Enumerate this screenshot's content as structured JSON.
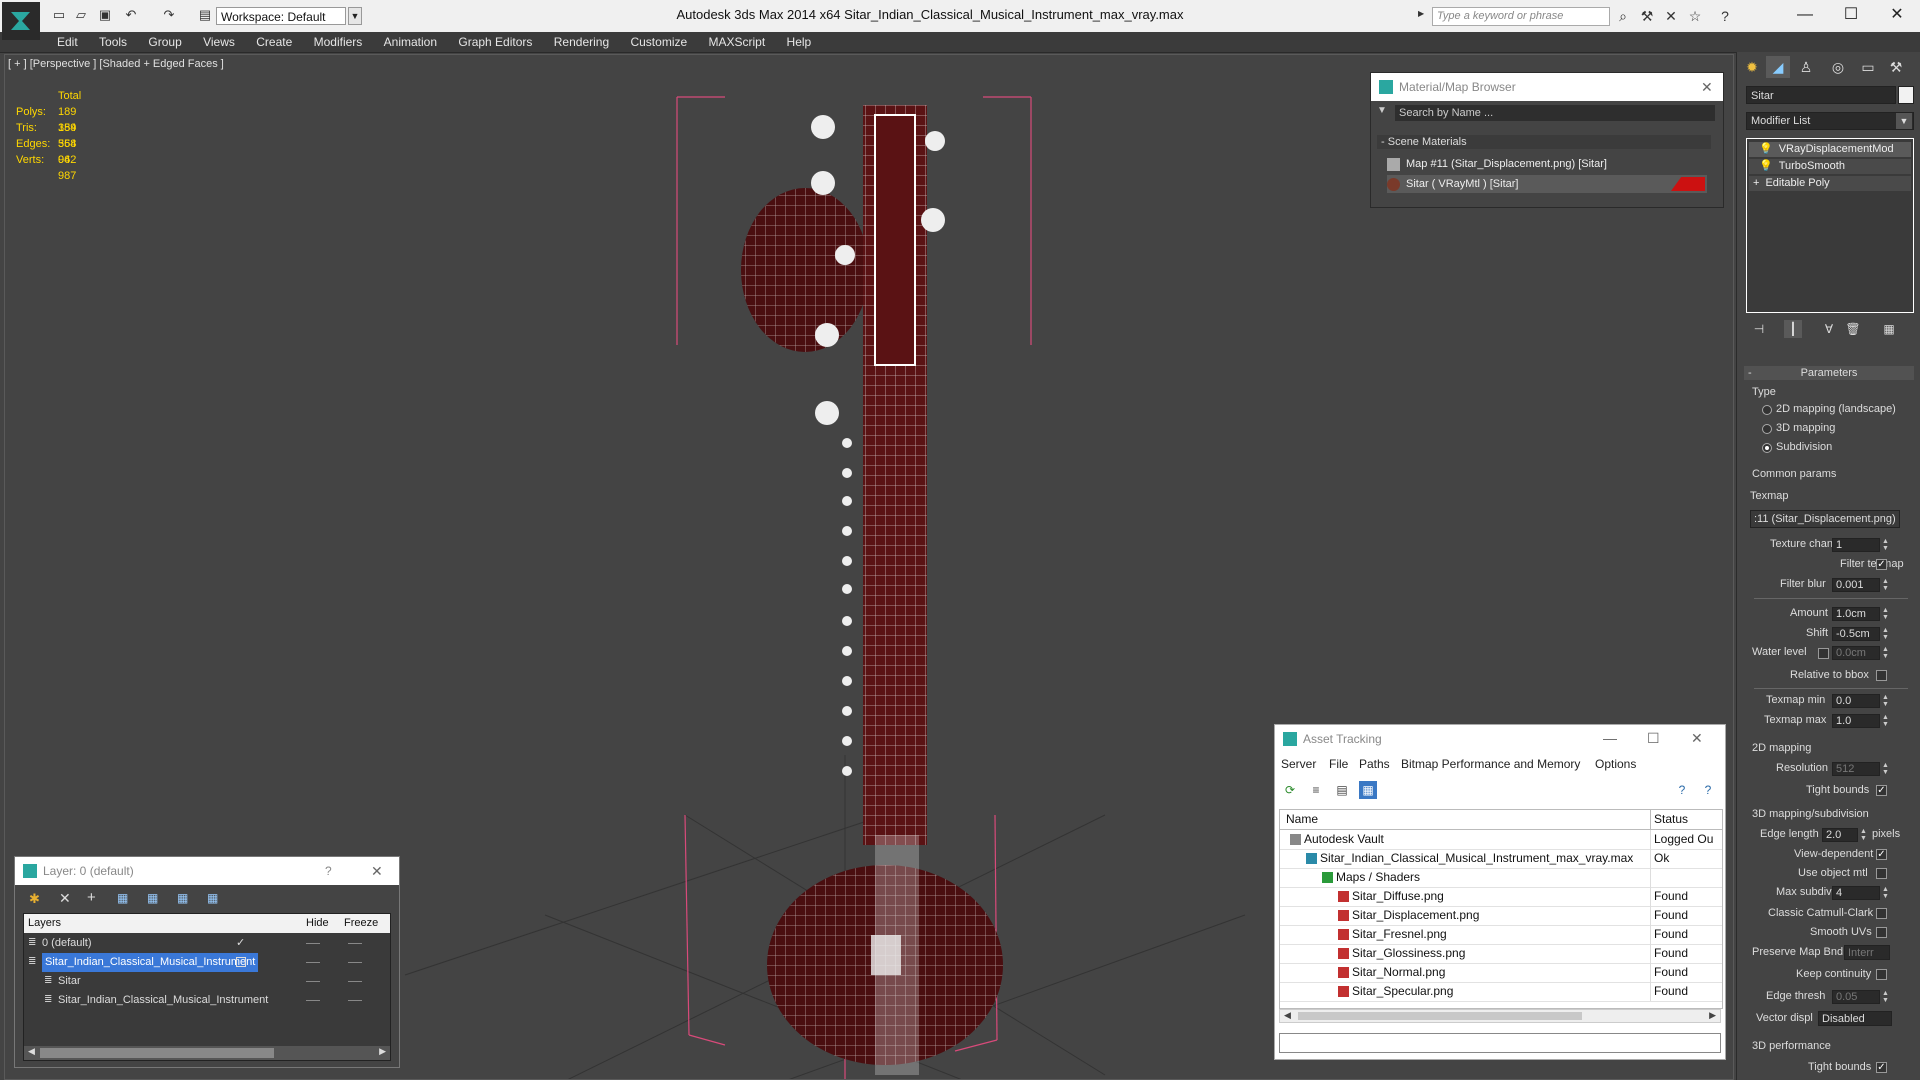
{
  "titlebar": {
    "workspace": "Workspace: Default",
    "title": "Autodesk 3ds Max  2014 x64      Sitar_Indian_Classical_Musical_Instrument_max_vray.max",
    "search_placeholder": "Type a keyword or phrase"
  },
  "menu": [
    "Edit",
    "Tools",
    "Group",
    "Views",
    "Create",
    "Modifiers",
    "Animation",
    "Graph Editors",
    "Rendering",
    "Customize",
    "MAXScript",
    "Help"
  ],
  "viewport": {
    "label": "[ + ] [Perspective ] [Shaded + Edged Faces ]",
    "stats": {
      "header": "Total",
      "rows": [
        {
          "label": "Polys:",
          "value": "189 354"
        },
        {
          "label": "Tris:",
          "value": "189 354"
        },
        {
          "label": "Edges:",
          "value": "568 062"
        },
        {
          "label": "Verts:",
          "value": "94 987"
        }
      ]
    }
  },
  "material_browser": {
    "title": "Material/Map Browser",
    "search": "Search by Name ...",
    "section": "Scene Materials",
    "items": [
      "Map #11 (Sitar_Displacement.png)  [Sitar]",
      "Sitar  ( VRayMtl )  [Sitar]"
    ],
    "accent": "#cc1111"
  },
  "asset_tracking": {
    "title": "Asset Tracking",
    "menu": [
      "Server",
      "File",
      "Paths",
      "Bitmap Performance and Memory",
      "Options"
    ],
    "columns": {
      "name": "Name",
      "status": "Status"
    },
    "rows": [
      {
        "name": "Autodesk Vault",
        "status": "Logged Ou",
        "indent": 24
      },
      {
        "name": "Sitar_Indian_Classical_Musical_Instrument_max_vray.max",
        "status": "Ok",
        "indent": 40
      },
      {
        "name": "Maps / Shaders",
        "status": "",
        "indent": 56
      },
      {
        "name": "Sitar_Diffuse.png",
        "status": "Found",
        "indent": 72
      },
      {
        "name": "Sitar_Displacement.png",
        "status": "Found",
        "indent": 72
      },
      {
        "name": "Sitar_Fresnel.png",
        "status": "Found",
        "indent": 72
      },
      {
        "name": "Sitar_Glossiness.png",
        "status": "Found",
        "indent": 72
      },
      {
        "name": "Sitar_Normal.png",
        "status": "Found",
        "indent": 72
      },
      {
        "name": "Sitar_Specular.png",
        "status": "Found",
        "indent": 72
      }
    ]
  },
  "layer_window": {
    "title": "Layer: 0 (default)",
    "help": "?",
    "columns": {
      "layers": "Layers",
      "hide": "Hide",
      "freeze": "Freeze"
    },
    "rows": [
      {
        "name": "0 (default)",
        "selected": false,
        "indent": 18
      },
      {
        "name": "Sitar_Indian_Classical_Musical_Instrument",
        "selected": true,
        "indent": 18
      },
      {
        "name": "Sitar",
        "selected": false,
        "indent": 34
      },
      {
        "name": "Sitar_Indian_Classical_Musical_Instrument",
        "selected": false,
        "indent": 34
      }
    ],
    "check": "✓"
  },
  "command_panel": {
    "object_name": "Sitar",
    "modifier_list": "Modifier List",
    "stack": [
      "VRayDisplacementMod",
      "TurboSmooth",
      "Editable Poly"
    ],
    "params": {
      "rollout": "Parameters",
      "type_label": "Type",
      "types": [
        "2D mapping (landscape)",
        "3D mapping",
        "Subdivision"
      ],
      "common": "Common params",
      "texmap_label": "Texmap",
      "texmap_value": ":11 (Sitar_Displacement.png)",
      "texture_chan": {
        "label": "Texture chan",
        "value": "1"
      },
      "filter_texmap": "Filter texmap",
      "filter_blur": {
        "label": "Filter blur",
        "value": "0.001"
      },
      "amount": {
        "label": "Amount",
        "value": "1.0cm"
      },
      "shift": {
        "label": "Shift",
        "value": "-0.5cm"
      },
      "water_level": {
        "label": "Water level",
        "value": "0.0cm"
      },
      "relative_bbox": "Relative to bbox",
      "texmap_min": {
        "label": "Texmap min",
        "value": "0.0"
      },
      "texmap_max": {
        "label": "Texmap max",
        "value": "1.0"
      },
      "mapping2d": "2D mapping",
      "resolution": {
        "label": "Resolution",
        "value": "512"
      },
      "tight_bounds": "Tight bounds",
      "mapping3d": "3D mapping/subdivision",
      "edge_length": {
        "label": "Edge length",
        "value": "2.0",
        "unit": "pixels"
      },
      "view_dependent": "View-dependent",
      "use_object_mtl": "Use object mtl",
      "max_subdivs": {
        "label": "Max subdivs",
        "value": "4"
      },
      "catmull": "Classic Catmull-Clark",
      "smooth_uvs": "Smooth UVs",
      "preserve": {
        "label": "Preserve Map Bnd",
        "value": "Interr"
      },
      "keep_continuity": "Keep continuity",
      "edge_thresh": {
        "label": "Edge thresh",
        "value": "0.05"
      },
      "vector_displ": {
        "label": "Vector displ",
        "value": "Disabled"
      },
      "perf": "3D performance",
      "tight_bounds2": "Tight bounds"
    }
  }
}
